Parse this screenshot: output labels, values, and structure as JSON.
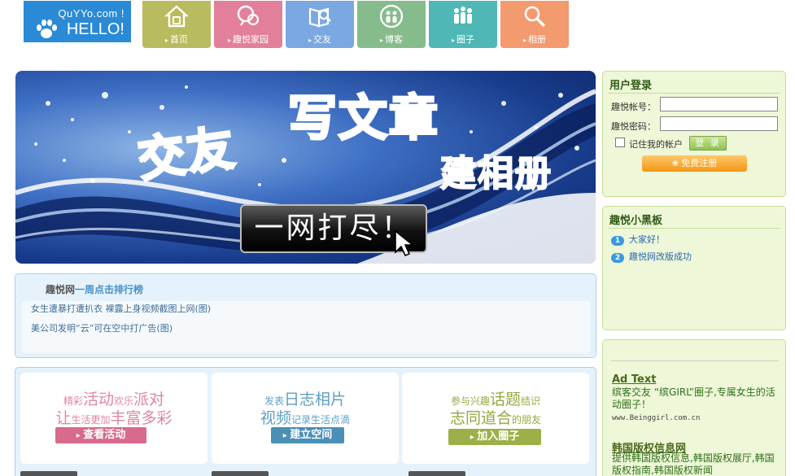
{
  "logo": {
    "brand": "QuYYo.com !",
    "hello": "HELLO!",
    "icon": "paw-icon"
  },
  "nav": {
    "items": [
      {
        "label": "首页",
        "icon": "home-icon",
        "color": "#b9bb5f"
      },
      {
        "label": "趣悦家园",
        "icon": "chat-icon",
        "color": "#e2809c"
      },
      {
        "label": "交友",
        "icon": "book-search-icon",
        "color": "#7aa8e2"
      },
      {
        "label": "博客",
        "icon": "people-icon",
        "color": "#86bc8c"
      },
      {
        "label": "圈子",
        "icon": "group-icon",
        "color": "#4fb7b6"
      },
      {
        "label": "相册",
        "icon": "search-icon",
        "color": "#f39a6e"
      }
    ]
  },
  "banner": {
    "text1": "交友",
    "text2": "写文章",
    "text3": "建相册",
    "button": "一网打尽！"
  },
  "rank": {
    "title_site": "趣悦网",
    "title_rest": "一周点击排行榜",
    "items": [
      "女生遭暴打遭扒衣 裸露上身视频截图上网(图)",
      "美公司发明“云”可在空中打广告(图)"
    ]
  },
  "features": [
    {
      "line1_a": "精彩",
      "line1_b": "活动",
      "line1_c": "欢乐",
      "line1_d": "派对",
      "line2_a": "让",
      "line2_b": "生活更加",
      "line2_c": "丰富多彩",
      "button": "查看活动",
      "color": "#e0879f",
      "btn_color": "#d86a8c"
    },
    {
      "line1_a": "发表",
      "line1_b": "日志相片",
      "line1_c": "",
      "line1_d": "",
      "line2_a": "视频",
      "line2_b": "记录生活点滴",
      "line2_c": "",
      "button": "建立空间",
      "color": "#5d9fc5",
      "btn_color": "#4a8fb6"
    },
    {
      "line1_a": "参与兴趣",
      "line1_b": "话题",
      "line1_c": "结识",
      "line1_d": "",
      "line2_a": "志同道合",
      "line2_b": "的朋友",
      "line2_c": "",
      "button": "加入圈子",
      "color": "#97a83e",
      "btn_color": "#9cb04a"
    }
  ],
  "login": {
    "title": "用户登录",
    "account_label": "趣悦帐号：",
    "password_label": "趣悦密码：",
    "account_value": "",
    "password_value": "",
    "remember": "记住我的帐户",
    "submit": "登 录",
    "register": "免费注册"
  },
  "board": {
    "title": "趣悦小黑板",
    "items": [
      {
        "num": "1",
        "text": "大家好！"
      },
      {
        "num": "2",
        "text": "趣悦网改版成功"
      }
    ]
  },
  "ads": [
    {
      "head": "Ad Text",
      "desc": "缤客交友 “缤GIRL”圈子,专属女生的活动圈子！",
      "url": "www.Beinggirl.com.cn"
    },
    {
      "head": "韩国版权信息网",
      "desc": "提供韩国版权信息,韩国版权展厅,韩国版权指南,韩国版权新闻",
      "url": ""
    }
  ]
}
